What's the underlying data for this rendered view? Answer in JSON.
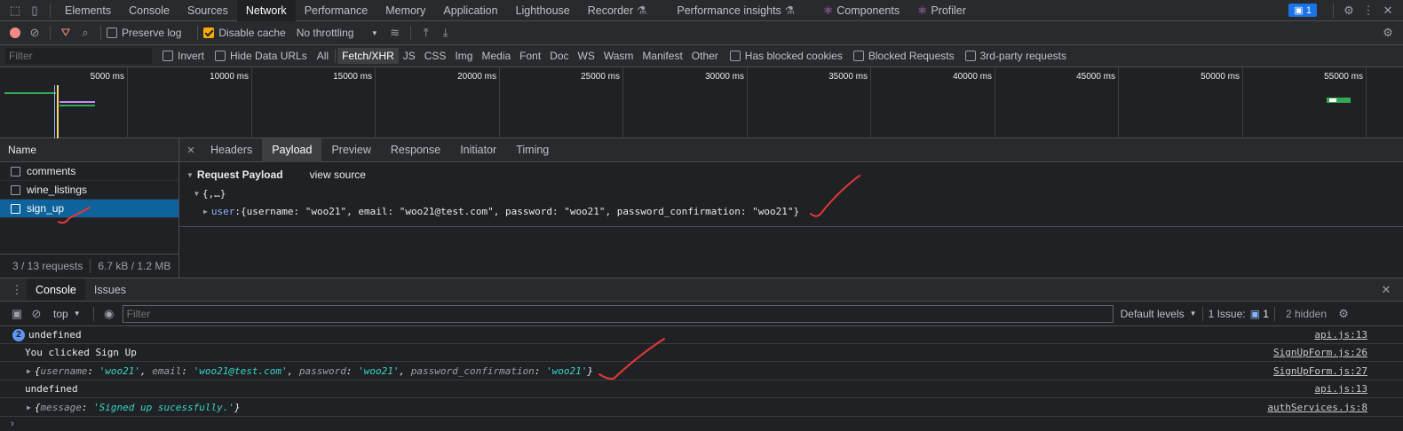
{
  "tabs": [
    "Elements",
    "Console",
    "Sources",
    "Network",
    "Performance",
    "Memory",
    "Application",
    "Lighthouse",
    "Recorder",
    "Performance insights",
    "Components",
    "Profiler"
  ],
  "active_tab": "Network",
  "issues_badge": "1",
  "toolbar": {
    "preserve_log": "Preserve log",
    "disable_cache": "Disable cache",
    "throttling": "No throttling"
  },
  "filter": {
    "placeholder": "Filter",
    "invert": "Invert",
    "hide_data_urls": "Hide Data URLs",
    "types": [
      "All",
      "Fetch/XHR",
      "JS",
      "CSS",
      "Img",
      "Media",
      "Font",
      "Doc",
      "WS",
      "Wasm",
      "Manifest",
      "Other"
    ],
    "active_type": "Fetch/XHR",
    "blocked_cookies": "Has blocked cookies",
    "blocked_requests": "Blocked Requests",
    "third_party": "3rd-party requests"
  },
  "timeline_labels": [
    "5000 ms",
    "10000 ms",
    "15000 ms",
    "20000 ms",
    "25000 ms",
    "30000 ms",
    "35000 ms",
    "40000 ms",
    "45000 ms",
    "50000 ms",
    "55000 ms"
  ],
  "requests": {
    "header": "Name",
    "items": [
      "comments",
      "wine_listings",
      "sign_up"
    ],
    "selected": "sign_up",
    "footer_count": "3 / 13 requests",
    "footer_size": "6.7 kB / 1.2 MB"
  },
  "detail": {
    "tabs": [
      "Headers",
      "Payload",
      "Preview",
      "Response",
      "Initiator",
      "Timing"
    ],
    "active": "Payload",
    "section_title": "Request Payload",
    "view_source": "view source",
    "root": "{,…}",
    "user_key": "user",
    "user_value": "{username: \"woo21\", email: \"woo21@test.com\", password: \"woo21\", password_confirmation: \"woo21\"}"
  },
  "drawer": {
    "tabs": [
      "Console",
      "Issues"
    ],
    "context": "top",
    "filter_placeholder": "Filter",
    "levels": "Default levels",
    "issues_label": "1 Issue:",
    "issues_count": "1",
    "hidden": "2 hidden"
  },
  "console": {
    "badge": "2",
    "l1_text": "undefined",
    "l1_src": "api.js:13",
    "l2_text": "You clicked Sign Up",
    "l2_src": "SignUpForm.js:26",
    "l3_username_key": "username",
    "l3_username": "'woo21'",
    "l3_email_key": "email",
    "l3_email": "'woo21@test.com'",
    "l3_password_key": "password",
    "l3_password": "'woo21'",
    "l3_confirm_key": "password_confirmation",
    "l3_confirm": "'woo21'",
    "l3_src": "SignUpForm.js:27",
    "l4_text": "undefined",
    "l4_src": "api.js:13",
    "l5_key": "message",
    "l5_value": "'Signed up sucessfully.'",
    "l5_src": "authServices.js:8"
  },
  "colors": {
    "accent": "#8ab4f8",
    "selected_row": "#0e639c",
    "annotation": "#e53935",
    "string": "#35d4c7"
  }
}
